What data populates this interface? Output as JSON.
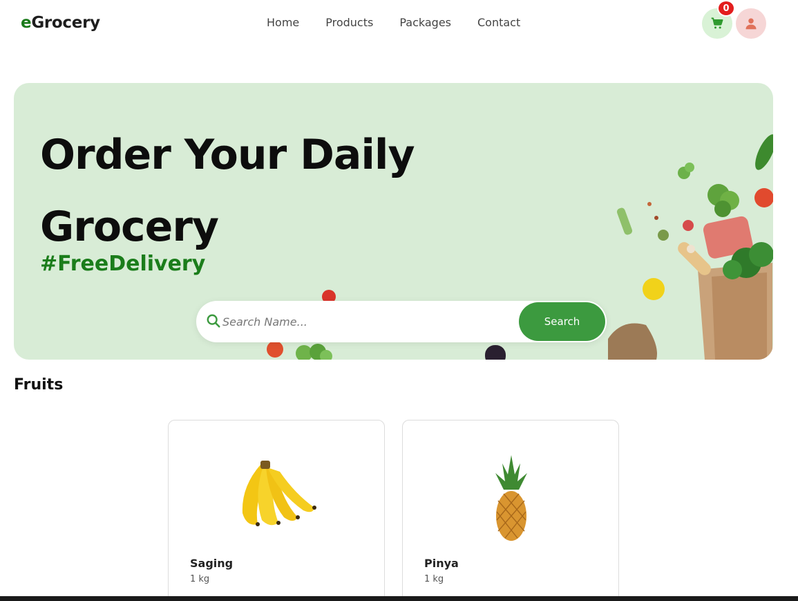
{
  "brand": {
    "prefix": "e",
    "name": "Grocery"
  },
  "nav": [
    {
      "label": "Home"
    },
    {
      "label": "Products"
    },
    {
      "label": "Packages"
    },
    {
      "label": "Contact"
    }
  ],
  "cart": {
    "count": "0",
    "icon": "cart-icon"
  },
  "user": {
    "icon": "user-icon"
  },
  "hero": {
    "title": "Order Your Daily Grocery",
    "tag": "#FreeDelivery"
  },
  "search": {
    "placeholder": "Search Name...",
    "value": "",
    "button_label": "Search"
  },
  "section": {
    "title": "Fruits"
  },
  "products": [
    {
      "name": "Saging",
      "unit": "1 kg",
      "icon": "banana-icon"
    },
    {
      "name": "Pinya",
      "unit": "1 kg",
      "icon": "pineapple-icon"
    }
  ],
  "colors": {
    "accent": "#3c9a3f",
    "hero_bg": "#d8ecd6",
    "tag": "#1b7d1b",
    "badge": "#e31e1e"
  }
}
